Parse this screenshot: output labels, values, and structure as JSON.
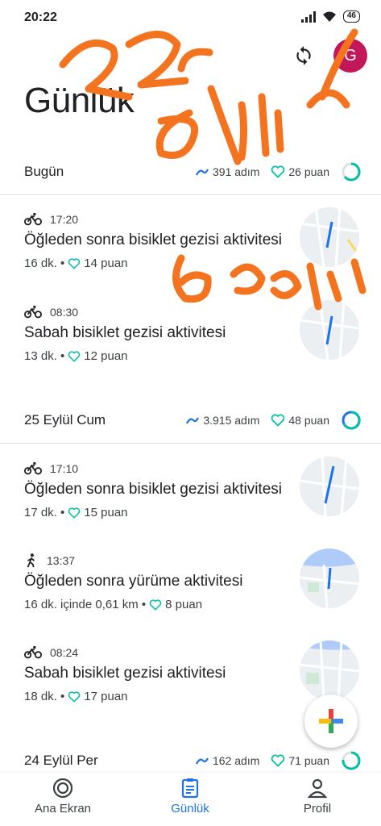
{
  "status_bar": {
    "time": "20:22",
    "battery": "46"
  },
  "header": {
    "title": "Günlük",
    "avatar_letter": "G"
  },
  "days": [
    {
      "label": "Bugün",
      "steps": "391 adım",
      "points": "26 puan"
    },
    {
      "label": "25 Eylül Cum",
      "steps": "3.915 adım",
      "points": "48 puan"
    },
    {
      "label": "24 Eylül Per",
      "steps": "162 adım",
      "points": "71 puan"
    }
  ],
  "activities": [
    {
      "time": "17:20",
      "title": "Öğleden sonra bisiklet gezisi aktivitesi",
      "detail": "16 dk. •",
      "points": "14 puan",
      "icon": "bike-icon"
    },
    {
      "time": "08:30",
      "title": "Sabah bisiklet gezisi aktivitesi",
      "detail": "13 dk. •",
      "points": "12 puan",
      "icon": "bike-icon"
    },
    {
      "time": "17:10",
      "title": "Öğleden sonra bisiklet gezisi aktivitesi",
      "detail": "17 dk. •",
      "points": "15 puan",
      "icon": "bike-icon"
    },
    {
      "time": "13:37",
      "title": "Öğleden sonra yürüme aktivitesi",
      "detail": "16 dk. içinde 0,61 km •",
      "points": "8 puan",
      "icon": "walk-icon"
    },
    {
      "time": "08:24",
      "title": "Sabah bisiklet gezisi aktivitesi",
      "detail": "18 dk. •",
      "points": "17 puan",
      "icon": "bike-icon"
    }
  ],
  "nav": [
    {
      "label": "Ana Ekran",
      "icon": "home-ring-icon"
    },
    {
      "label": "Günlük",
      "icon": "journal-icon"
    },
    {
      "label": "Profil",
      "icon": "person-icon"
    }
  ],
  "colors": {
    "accent": "#1a73e8",
    "heart_green": "#00bfa5",
    "steps_blue": "#1a73e8",
    "avatar": "#c2185b",
    "scribble": "#f4731f"
  }
}
